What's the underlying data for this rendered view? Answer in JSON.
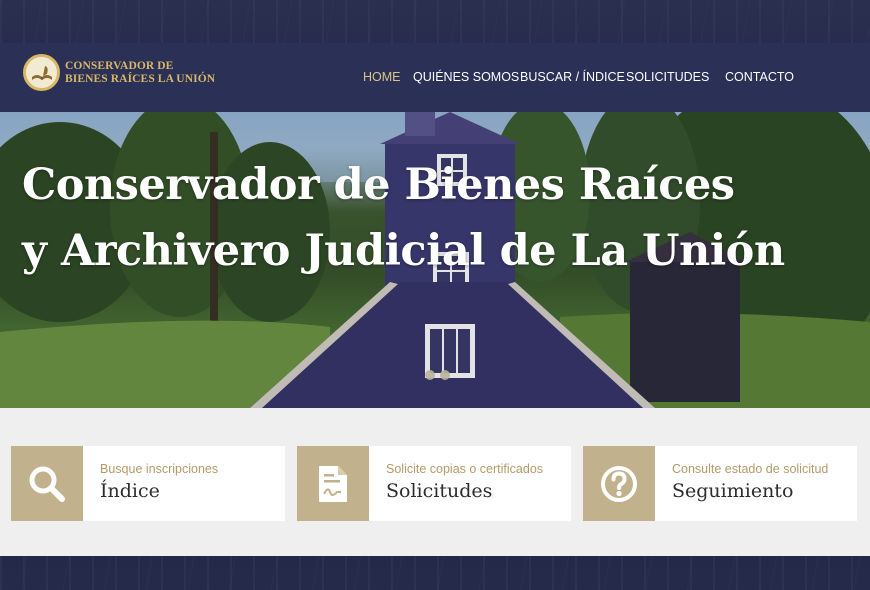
{
  "colors": {
    "navbar_bg": "#2a3056",
    "gold_accent": "#d8b766",
    "active_nav": "#d8c48a",
    "card_icon_bg": "#c1b28d",
    "card_subtitle": "#b49a6a",
    "band_bg": "#efefef"
  },
  "logo": {
    "line1": "CONSERVADOR DE",
    "line2": "BIENES RAÍCES LA UNIÓN",
    "icon": "open-book-quill-icon"
  },
  "nav": {
    "items": [
      {
        "label": "HOME",
        "active": true
      },
      {
        "label": "QUIÉNES SOMOS",
        "active": false
      },
      {
        "label": "BUSCAR / ÍNDICE",
        "active": false
      },
      {
        "label": "SOLICITUDES",
        "active": false
      },
      {
        "label": "CONTACTO",
        "active": false
      }
    ]
  },
  "hero": {
    "title_line1": "Conservador de Bienes Raíces",
    "title_line2": "y Archivero Judicial de La Unión",
    "slides": 2,
    "current_slide": 1
  },
  "cards": [
    {
      "subtitle": "Busque inscripciones",
      "title": "Índice",
      "icon": "search-icon"
    },
    {
      "subtitle": "Solicite copias o certificados",
      "title": "Solicitudes",
      "icon": "document-icon"
    },
    {
      "subtitle": "Consulte estado de solicitud",
      "title": "Seguimiento",
      "icon": "question-circle-icon"
    }
  ]
}
